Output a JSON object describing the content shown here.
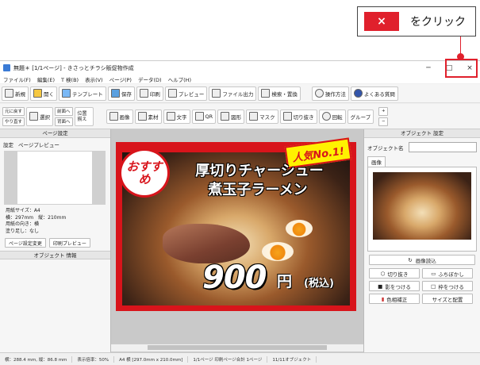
{
  "callout": {
    "x_label": "×",
    "text": "をクリック"
  },
  "window": {
    "title": "無題＊ [1/1ページ] - きさっとチラシ販促物作成",
    "controls": {
      "minimize": "─",
      "maximize": "□",
      "close": "×"
    }
  },
  "menu": [
    "ファイル(F)",
    "編集(E)",
    "T 検(B)",
    "表示(V)",
    "ページ(P)",
    "データ(D)",
    "ヘルプ(H)"
  ],
  "toolbar1": {
    "new": "新規",
    "open": "開く",
    "template": "テンプレート",
    "save": "保存",
    "print": "印刷",
    "preview": "プレビュー",
    "export": "ファイル出力",
    "search": "検索・置換",
    "howto": "操作方法",
    "faq": "よくある質問"
  },
  "toolbar2": {
    "undo": "元に戻す",
    "redo": "やり直す",
    "select": "選択",
    "front": "前面へ",
    "back": "背面へ",
    "align": "位置揃え",
    "image": "画像",
    "material": "素材",
    "text": "文字",
    "qr": "QR",
    "shape": "図形",
    "mask": "マスク",
    "crop": "切り抜き",
    "rotate": "回転",
    "group": "グループ"
  },
  "left_panel": {
    "header": "ページ設定",
    "tab_settings": "設定",
    "tab_preview": "ページプレビュー",
    "paper_size": "用紙サイズ：A4",
    "dimensions": "横：297mm　縦：210mm",
    "orientation": "用紙の向き：横",
    "bleed": "塗り足し：なし",
    "change_button": "ページ設定変更",
    "print_preview_button": "印刷プレビュー",
    "object_info_header": "オブジェクト 情報"
  },
  "poster": {
    "badge": "おすすめ",
    "popular": "人気No.1!",
    "headline1": "厚切りチャーシュー",
    "headline2": "煮玉子ラーメン",
    "price": "900",
    "yen": "円",
    "tax": "(税込)"
  },
  "right_panel": {
    "header": "オブジェクト 設定",
    "name_label": "オブジェクト名",
    "tab_image": "画像",
    "load_button": "画像読込",
    "buttons": [
      "切り抜き",
      "ふちぼかし",
      "影をつける",
      "枠をつける",
      "色相補正",
      "サイズと配置"
    ]
  },
  "status": {
    "coords": "横：288.4 mm, 縦：86.8 mm",
    "zoom": "表示倍率：50%",
    "paper": "A4 横 [297.0mm x 210.0mm]",
    "page": "1/1ページ 印刷ページ合計 1ページ",
    "objects": "11/11オブジェクト"
  }
}
